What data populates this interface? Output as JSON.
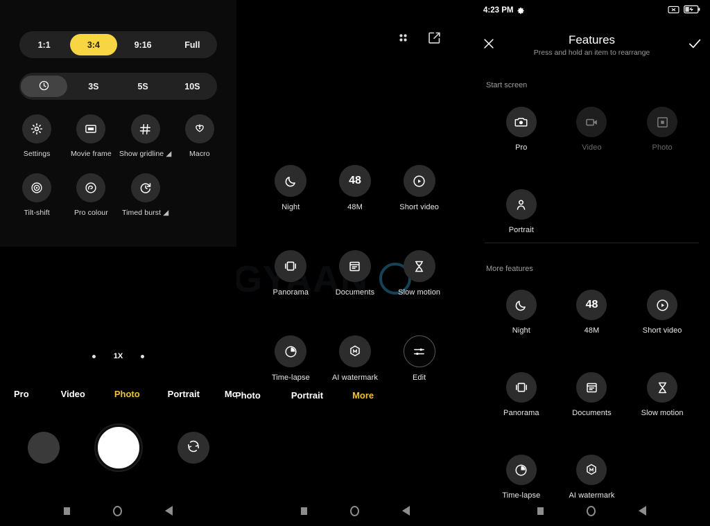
{
  "app": {
    "name": "Camera",
    "theme_dark": "#000000",
    "accent_yellow": "#f7d543",
    "accent_tab": "#f1c232"
  },
  "left_panel": {
    "aspect_ratio": {
      "options": [
        "1:1",
        "3:4",
        "9:16",
        "Full"
      ],
      "selected": "3:4"
    },
    "timer": {
      "options": [
        "timer-icon",
        "3S",
        "5S",
        "10S"
      ],
      "labels": [
        "",
        "3S",
        "5S",
        "10S"
      ],
      "selected_index": 0
    },
    "settings_items": [
      {
        "icon": "settings-gear-icon",
        "label": "Settings",
        "has_arrow": false
      },
      {
        "icon": "movie-frame-icon",
        "label": "Movie frame",
        "has_arrow": false
      },
      {
        "icon": "gridlines-icon",
        "label": "Show gridline",
        "has_arrow": true
      },
      {
        "icon": "macro-flower-icon",
        "label": "Macro",
        "has_arrow": false
      },
      {
        "icon": "tilt-shift-icon",
        "label": "Tilt-shift",
        "has_arrow": false
      },
      {
        "icon": "pro-colour-icon",
        "label": "Pro colour",
        "has_arrow": false
      },
      {
        "icon": "timed-burst-icon",
        "label": "Timed burst",
        "has_arrow": true
      }
    ],
    "zoom": {
      "value": "1X"
    },
    "mode_tabs": [
      {
        "label": "Pro",
        "active": false
      },
      {
        "label": "Video",
        "active": false
      },
      {
        "label": "Photo",
        "active": true
      },
      {
        "label": "Portrait",
        "active": false
      },
      {
        "label": "More",
        "active": false
      }
    ],
    "controls": {
      "thumbnail": "gallery-thumbnail",
      "shutter": "shutter-button",
      "flip": "flip-camera-icon"
    }
  },
  "mid_panel": {
    "top_icons": [
      {
        "icon": "grid-dots-icon",
        "label": "Layout"
      },
      {
        "icon": "edit-square-icon",
        "label": "Edit"
      }
    ],
    "features": [
      {
        "icon": "night-moon-icon",
        "label": "Night",
        "outlined": false
      },
      {
        "icon": "48m-icon",
        "label": "48M",
        "outlined": false
      },
      {
        "icon": "short-video-icon",
        "label": "Short video",
        "outlined": false
      },
      {
        "icon": "panorama-icon",
        "label": "Panorama",
        "outlined": false
      },
      {
        "icon": "documents-icon",
        "label": "Documents",
        "outlined": false
      },
      {
        "icon": "slow-motion-icon",
        "label": "Slow motion",
        "outlined": false
      },
      {
        "icon": "time-lapse-icon",
        "label": "Time-lapse",
        "outlined": false
      },
      {
        "icon": "ai-watermark-icon",
        "label": "AI watermark",
        "outlined": false
      },
      {
        "icon": "edit-sliders-icon",
        "label": "Edit",
        "outlined": true
      }
    ],
    "mode_tabs": [
      {
        "label": "Photo",
        "active": false
      },
      {
        "label": "Portrait",
        "active": false
      },
      {
        "label": "More",
        "active": true
      }
    ],
    "watermark": {
      "text": "MOBIGYAAN"
    }
  },
  "right_panel": {
    "status_bar": {
      "time": "4:23 PM",
      "left_icons": [
        "gear-icon"
      ],
      "right_icons": [
        "no-sim-icon",
        "battery-charging-icon"
      ]
    },
    "header": {
      "close_icon": "close-x-icon",
      "title": "Features",
      "subtitle": "Press and hold an item to rearrange",
      "confirm_icon": "check-icon"
    },
    "sections": [
      {
        "label": "Start screen",
        "items": [
          {
            "icon": "pro-camera-icon",
            "label": "Pro",
            "dimmed": false
          },
          {
            "icon": "video-camera-icon",
            "label": "Video",
            "dimmed": true
          },
          {
            "icon": "photo-icon",
            "label": "Photo",
            "dimmed": true
          },
          {
            "icon": "portrait-person-icon",
            "label": "Portrait",
            "dimmed": false
          }
        ]
      },
      {
        "label": "More features",
        "items": [
          {
            "icon": "night-moon-icon",
            "label": "Night",
            "dimmed": false
          },
          {
            "icon": "48m-icon",
            "label": "48M",
            "dimmed": false
          },
          {
            "icon": "short-video-icon",
            "label": "Short video",
            "dimmed": false
          },
          {
            "icon": "panorama-icon",
            "label": "Panorama",
            "dimmed": false
          },
          {
            "icon": "documents-icon",
            "label": "Documents",
            "dimmed": false
          },
          {
            "icon": "slow-motion-icon",
            "label": "Slow motion",
            "dimmed": false
          },
          {
            "icon": "time-lapse-icon",
            "label": "Time-lapse",
            "dimmed": false
          },
          {
            "icon": "ai-watermark-icon",
            "label": "AI watermark",
            "dimmed": false
          }
        ]
      }
    ]
  },
  "navbar": {
    "buttons": [
      {
        "icon": "recents-square-icon",
        "label": "Recents"
      },
      {
        "icon": "home-circle-icon",
        "label": "Home"
      },
      {
        "icon": "back-triangle-icon",
        "label": "Back"
      }
    ]
  }
}
